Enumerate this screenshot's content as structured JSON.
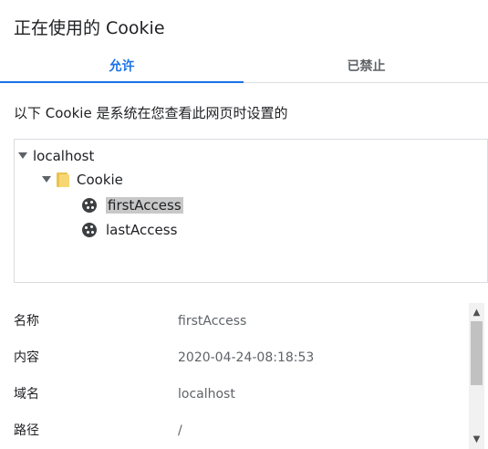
{
  "dialog": {
    "title": "正在使用的 Cookie"
  },
  "tabs": {
    "allowed": "允许",
    "blocked": "已禁止"
  },
  "description": "以下 Cookie 是系统在您查看此网页时设置的",
  "tree": {
    "root": "localhost",
    "folder": "Cookie",
    "items": [
      "firstAccess",
      "lastAccess"
    ],
    "selected": "firstAccess"
  },
  "details": [
    {
      "label": "名称",
      "value": "firstAccess"
    },
    {
      "label": "内容",
      "value": "2020-04-24-08:18:53"
    },
    {
      "label": "域名",
      "value": "localhost"
    },
    {
      "label": "路径",
      "value": "/"
    }
  ],
  "colors": {
    "accent": "#1a73e8",
    "selection": "#c8c8c8"
  }
}
